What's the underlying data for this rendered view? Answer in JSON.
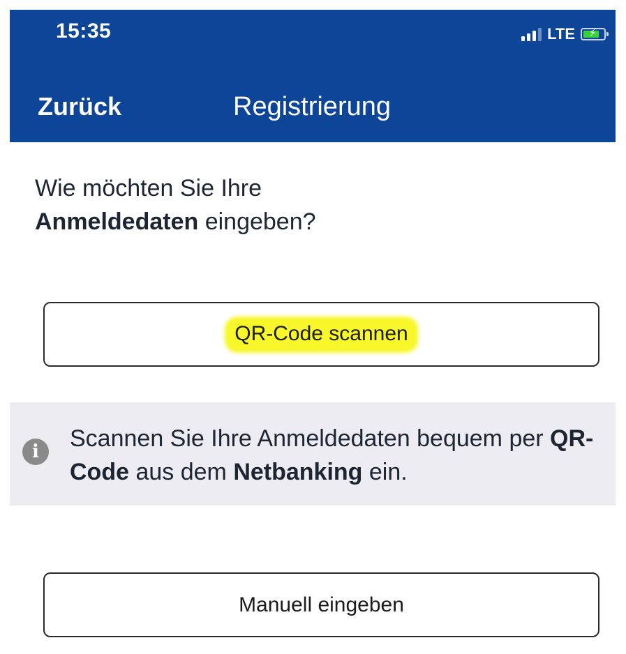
{
  "status_bar": {
    "time": "15:35",
    "network": "LTE",
    "signal_icon": "signal-bars-icon",
    "battery_icon": "battery-charging-icon"
  },
  "nav": {
    "back_label": "Zurück",
    "title": "Registrierung"
  },
  "question": {
    "part1": "Wie möchten Sie Ihre",
    "bold": "Anmeldedaten",
    "part2": " eingeben?"
  },
  "buttons": {
    "qr_label": "QR-Code scannen",
    "manual_label": "Manuell eingeben"
  },
  "info": {
    "icon": "info-icon",
    "text1": "Scannen Sie Ihre Anmeldedaten bequem per ",
    "bold1": "QR-Code",
    "text2": " aus dem ",
    "bold2": "Netbanking",
    "text3": " ein."
  },
  "colors": {
    "header_bg": "#0d4598",
    "info_bg": "#ececf2",
    "highlight": "#f7f72a",
    "battery": "#39d23a"
  }
}
